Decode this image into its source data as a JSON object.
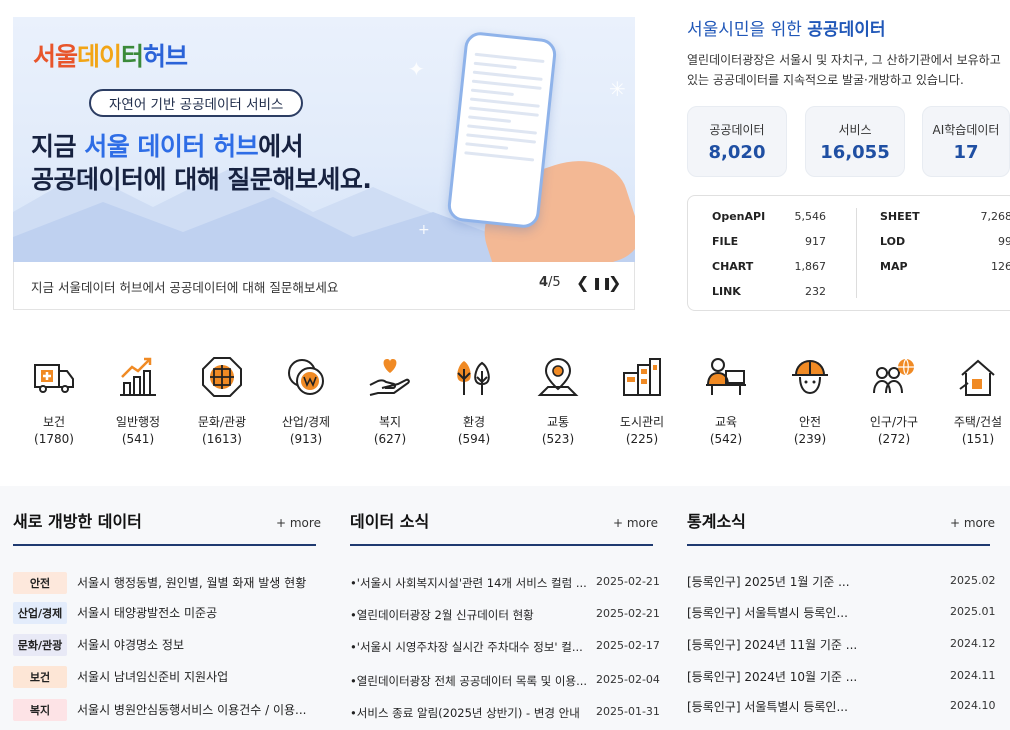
{
  "banner": {
    "logo": {
      "p1": "서울",
      "p2": "데이",
      "p3": "터",
      "p4": "허브"
    },
    "pill": "자연어 기반 공공데이터 서비스",
    "line1_pre": "지금 ",
    "line1_blue": "서울 데이터 허브",
    "line1_post": "에서",
    "line2": "공공데이터에 대해 질문해보세요.",
    "caption": "지금 서울데이터 허브에서 공공데이터에 대해 질문해보세요",
    "page_current": "4",
    "page_total": "/5",
    "prev": "❮",
    "pause": "❚❚",
    "next": "❯"
  },
  "info": {
    "title_pre": "서울시민을 위한 ",
    "title_bold": "공공데이터",
    "desc_line1": "열린데이터광장은 서울시 및 자치구, 그 산하기관에서 보유하고",
    "desc_line2": "있는 공공데이터를 지속적으로 발굴·개방하고 있습니다.",
    "stats": [
      {
        "label": "공공데이터",
        "value": "8,020"
      },
      {
        "label": "서비스",
        "value": "16,055"
      },
      {
        "label": "AI학습데이터",
        "value": "17"
      }
    ],
    "formats_left": [
      {
        "name": "OpenAPI",
        "count": "5,546"
      },
      {
        "name": "FILE",
        "count": "917"
      },
      {
        "name": "CHART",
        "count": "1,867"
      },
      {
        "name": "LINK",
        "count": "232"
      }
    ],
    "formats_right": [
      {
        "name": "SHEET",
        "count": "7,268"
      },
      {
        "name": "LOD",
        "count": "99"
      },
      {
        "name": "MAP",
        "count": "126"
      }
    ]
  },
  "categories": [
    {
      "name": "보건",
      "count": "(1780)",
      "icon": "ambulance-icon"
    },
    {
      "name": "일반행정",
      "count": "(541)",
      "icon": "bar-chart-icon"
    },
    {
      "name": "문화/관광",
      "count": "(1613)",
      "icon": "traditional-window-icon"
    },
    {
      "name": "산업/경제",
      "count": "(913)",
      "icon": "coin-icon"
    },
    {
      "name": "복지",
      "count": "(627)",
      "icon": "heart-hand-icon"
    },
    {
      "name": "환경",
      "count": "(594)",
      "icon": "trees-icon"
    },
    {
      "name": "교통",
      "count": "(523)",
      "icon": "map-pin-icon"
    },
    {
      "name": "도시관리",
      "count": "(225)",
      "icon": "buildings-icon"
    },
    {
      "name": "교육",
      "count": "(542)",
      "icon": "teacher-icon"
    },
    {
      "name": "안전",
      "count": "(239)",
      "icon": "helmet-icon"
    },
    {
      "name": "인구/가구",
      "count": "(272)",
      "icon": "people-globe-icon"
    },
    {
      "name": "주택/건설",
      "count": "(151)",
      "icon": "house-icon"
    }
  ],
  "new_data": {
    "title": "새로 개방한 데이터",
    "more": "+ more",
    "items": [
      {
        "badge": "안전",
        "text": "서울시 행정동별, 원인별, 월별 화재 발생 현황",
        "badge_bg": "#fde8dc",
        "badge_fg": "#222"
      },
      {
        "badge": "산업/경제",
        "text": "서울시 태양광발전소 미준공",
        "badge_bg": "#e3ecfb",
        "badge_fg": "#222"
      },
      {
        "badge": "문화/관광",
        "text": "서울시 야경명소 정보",
        "badge_bg": "#e8e9f6",
        "badge_fg": "#222"
      },
      {
        "badge": "보건",
        "text": "서울시 남녀임신준비 지원사업",
        "badge_bg": "#fde6d6",
        "badge_fg": "#222"
      },
      {
        "badge": "복지",
        "text": "서울시 병원안심동행서비스 이용건수 / 이용...",
        "badge_bg": "#fde3e6",
        "badge_fg": "#222"
      }
    ]
  },
  "news": {
    "title": "데이터 소식",
    "more": "+ more",
    "items": [
      {
        "text": "•'서울시 사회복지시설'관련 14개 서비스 컬럼 ...",
        "date": "2025-02-21"
      },
      {
        "text": "•열린데이터광장 2월 신규데이터 현황",
        "date": "2025-02-21"
      },
      {
        "text": "•'서울시 시영주차장 실시간 주차대수 정보' 컬...",
        "date": "2025-02-17"
      },
      {
        "text": "•열린데이터광장 전체 공공데이터 목록 및 이용...",
        "date": "2025-02-04"
      },
      {
        "text": "•서비스 종료 알림(2025년 상반기) - 변경 안내",
        "date": "2025-01-31"
      }
    ]
  },
  "stats_news": {
    "title": "통계소식",
    "more": "+ more",
    "items": [
      {
        "text": "[등록인구] 2025년 1월 기준 ...",
        "date": "2025.02"
      },
      {
        "text": "[등록인구] 서울특별시 등록인...",
        "date": "2025.01"
      },
      {
        "text": "[등록인구] 2024년 11월 기준 ...",
        "date": "2024.12"
      },
      {
        "text": "[등록인구] 2024년 10월 기준 ...",
        "date": "2024.11"
      },
      {
        "text": "[등록인구] 서울특별시 등록인...",
        "date": "2024.10"
      }
    ]
  },
  "colors": {
    "accent": "#2e6de6",
    "navy": "#1f3a70",
    "icon_orange": "#f08a24"
  }
}
